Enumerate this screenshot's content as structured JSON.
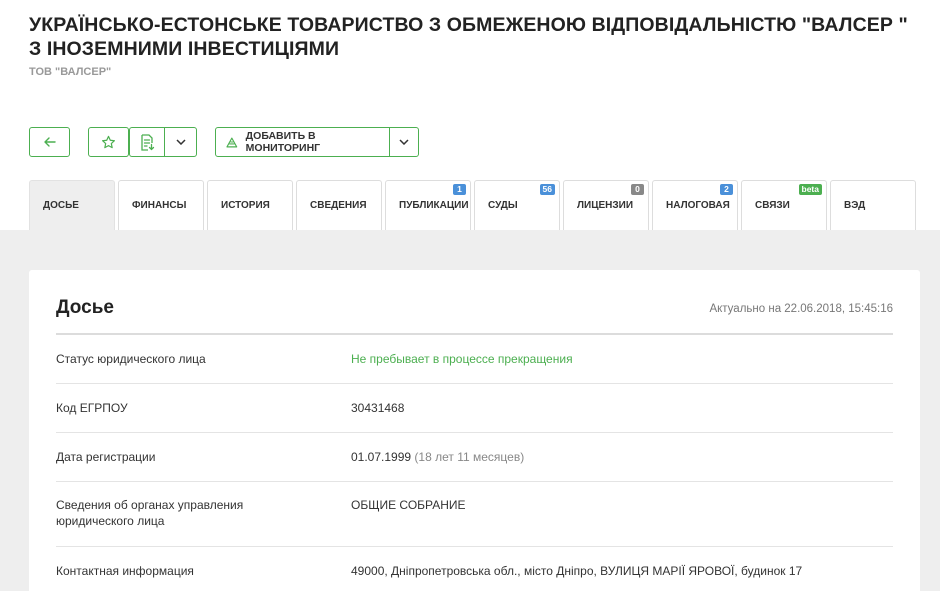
{
  "company": {
    "full_name": "УКРАЇНСЬКО-ЕСТОНСЬКЕ ТОВАРИСТВО З ОБМЕЖЕНОЮ ВІДПОВІДАЛЬНІСТЮ \"ВАЛСЕР \" З ІНОЗЕМНИМИ ІНВЕСТИЦІЯМИ",
    "short_name": "ТОВ \"ВАЛСЕР\""
  },
  "toolbar": {
    "monitor_label": "ДОБАВИТЬ В МОНИТОРИНГ"
  },
  "tabs": [
    {
      "label": "ДОСЬЕ",
      "badge": ""
    },
    {
      "label": "ФИНАНСЫ",
      "badge": ""
    },
    {
      "label": "ИСТОРИЯ",
      "badge": ""
    },
    {
      "label": "СВЕДЕНИЯ",
      "badge": ""
    },
    {
      "label": "ПУБЛИКАЦИИ",
      "badge": "1"
    },
    {
      "label": "СУДЫ",
      "badge": "56"
    },
    {
      "label": "ЛИЦЕНЗИИ",
      "badge": "0"
    },
    {
      "label": "НАЛОГОВАЯ",
      "badge": "2"
    },
    {
      "label": "СВЯЗИ",
      "badge": "beta"
    },
    {
      "label": "ВЭД",
      "badge": ""
    }
  ],
  "dossier": {
    "title": "Досье",
    "updated": "Актуально на 22.06.2018, 15:45:16",
    "rows": [
      {
        "label": "Статус юридического лица",
        "value": "Не пребывает в процессе прекращения"
      },
      {
        "label": "Код ЕГРПОУ",
        "value": "30431468"
      },
      {
        "label": "Дата регистрации",
        "value": "01.07.1999",
        "value_note": "(18 лет 11 месяцев)"
      },
      {
        "label": "Сведения об органах управления юридического лица",
        "value": "ОБЩИЕ СОБРАНИЕ"
      },
      {
        "label": "Контактная информация",
        "value": "49000, Дніпропетровська обл., місто Дніпро, ВУЛИЦЯ МАРІЇ ЯРОВОЇ, будинок 17"
      }
    ]
  },
  "colors": {
    "accent": "#4caf50",
    "badge_blue": "#4a90d9",
    "badge_gray": "#888888",
    "background": "#eeeeee"
  }
}
